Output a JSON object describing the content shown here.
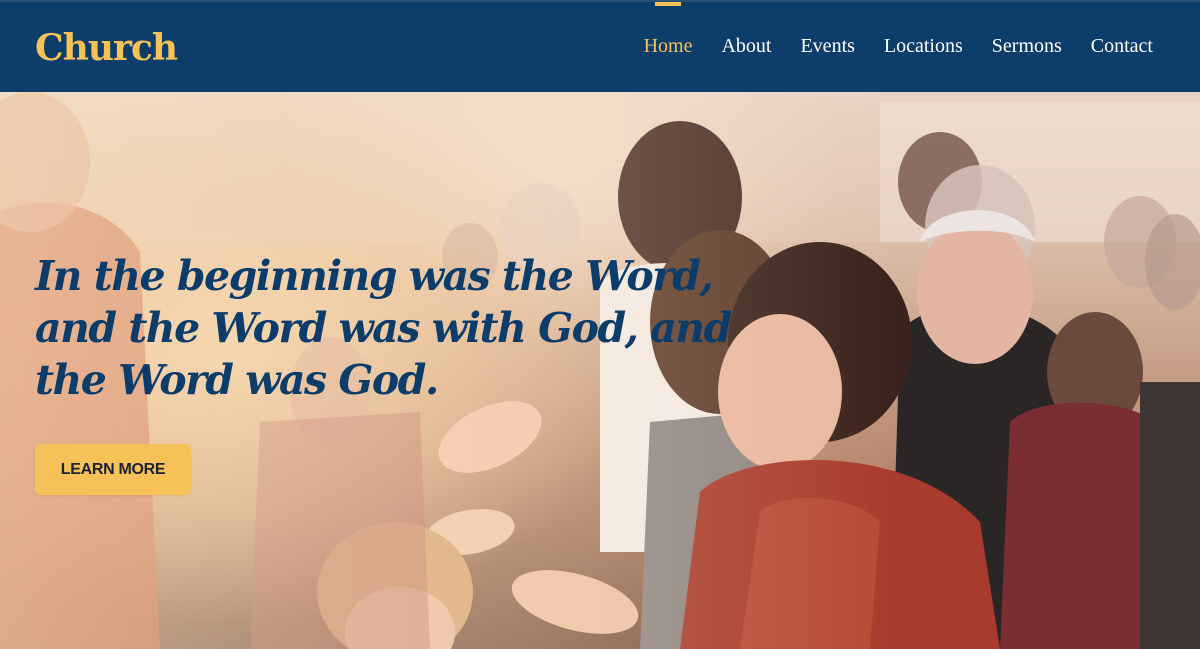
{
  "header": {
    "brand": "Church",
    "nav": [
      {
        "label": "Home",
        "active": true
      },
      {
        "label": "About",
        "active": false
      },
      {
        "label": "Events",
        "active": false
      },
      {
        "label": "Locations",
        "active": false
      },
      {
        "label": "Sermons",
        "active": false
      },
      {
        "label": "Contact",
        "active": false
      }
    ]
  },
  "hero": {
    "verse": "In the beginning was the Word, and the Word was with God, and the Word was God.",
    "cta_label": "LEARN MORE"
  },
  "colors": {
    "header_bg": "#0d3d6b",
    "accent": "#f6c257",
    "heading": "#0c3c6a"
  }
}
